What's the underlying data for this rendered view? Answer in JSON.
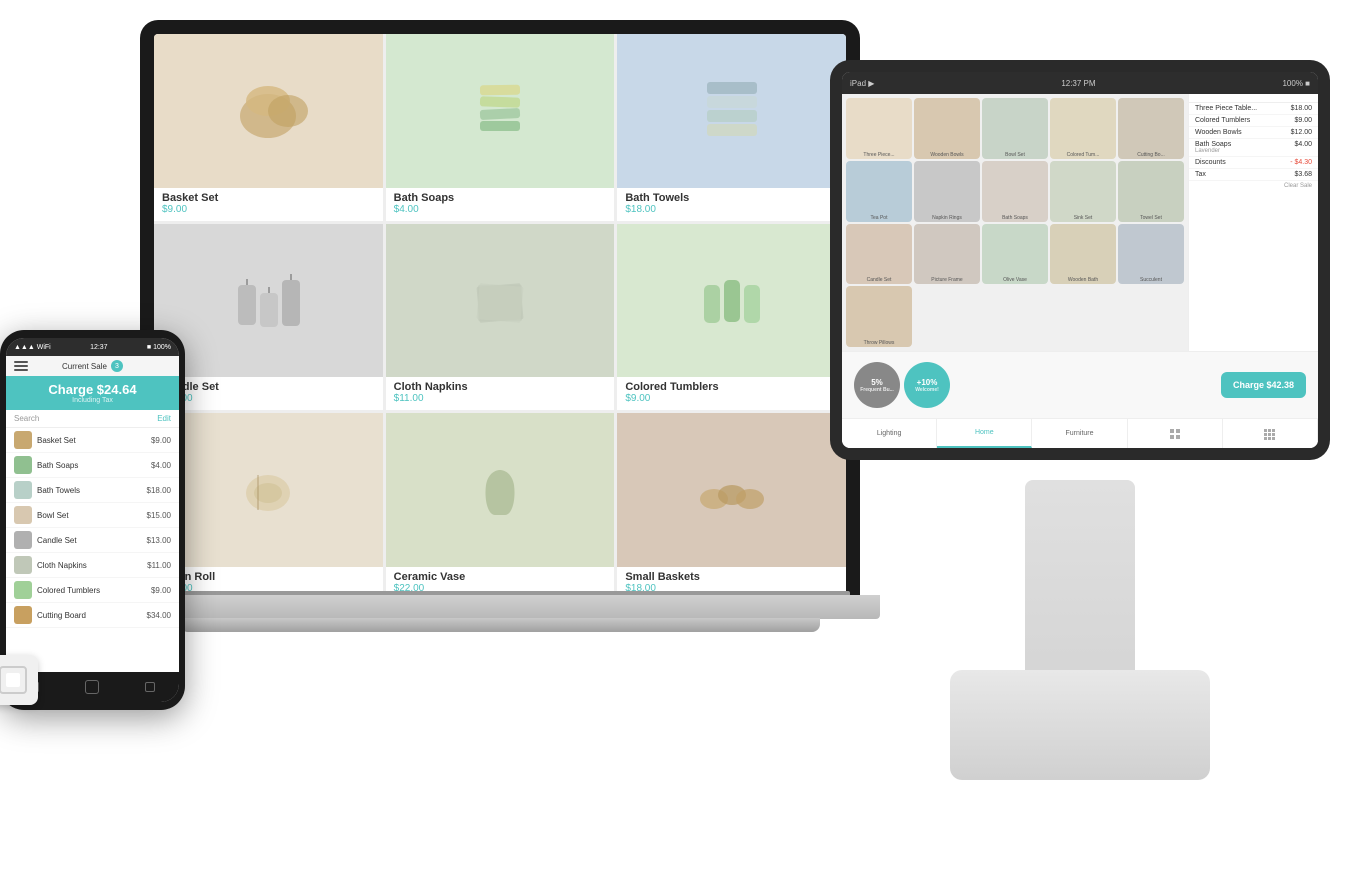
{
  "scene": {
    "bg": "#ffffff"
  },
  "laptop": {
    "products": [
      {
        "name": "Basket Set",
        "price": "$9.00",
        "bg": "#e8dcc8",
        "id": "basket"
      },
      {
        "name": "Bath Soaps",
        "price": "$4.00",
        "bg": "#d4e8d0",
        "id": "soaps"
      },
      {
        "name": "Bath Towels",
        "price": "$18.00",
        "bg": "#c8d8e8",
        "id": "towels"
      },
      {
        "name": "Candle Set",
        "price": "$13.00",
        "bg": "#d8d8d8",
        "id": "candles"
      },
      {
        "name": "Cloth Napkins",
        "price": "$11.00",
        "bg": "#d0d8c8",
        "id": "napkins"
      },
      {
        "name": "Colored Tumblers",
        "price": "$9.00",
        "bg": "#d8e8d0",
        "id": "tumblers"
      },
      {
        "name": "Linen Roll",
        "price": "$14.00",
        "bg": "#e8e0d0",
        "id": "roll"
      },
      {
        "name": "Ceramic Vase",
        "price": "$22.00",
        "bg": "#d8e0c8",
        "id": "vase"
      },
      {
        "name": "Small Baskets",
        "price": "$18.00",
        "bg": "#d8c8b8",
        "id": "baskets2"
      }
    ]
  },
  "pos": {
    "time": "12:37 PM",
    "products": [
      {
        "label": "Three Piece...",
        "bg": "pt1"
      },
      {
        "label": "Wooden Bowls",
        "bg": "pt2"
      },
      {
        "label": "Bowl Set",
        "bg": "pt3"
      },
      {
        "label": "Colored Tum...",
        "bg": "pt4"
      },
      {
        "label": "Cutting Bo...",
        "bg": "pt5"
      },
      {
        "label": "Tea Pot",
        "bg": "pt6"
      },
      {
        "label": "Napkin Rings",
        "bg": "pt7"
      },
      {
        "label": "Bath Soaps",
        "bg": "pt8"
      },
      {
        "label": "Sink Set",
        "bg": "pt9"
      },
      {
        "label": "Towel Set",
        "bg": "pt10"
      },
      {
        "label": "Candle Set",
        "bg": "pt11"
      },
      {
        "label": "Picture Frame",
        "bg": "pt12"
      },
      {
        "label": "Olive Vase",
        "bg": "pt13"
      },
      {
        "label": "Wooden Bath",
        "bg": "pt14"
      },
      {
        "label": "Succulent",
        "bg": "pt15"
      },
      {
        "label": "Throw Pillows",
        "bg": "pt1"
      }
    ],
    "cart_items": [
      {
        "name": "Three Piece Table...",
        "price": "$18.00"
      },
      {
        "name": "Colored Tumblers",
        "price": "$9.00"
      },
      {
        "name": "Wooden Bowls",
        "price": "$12.00"
      },
      {
        "name": "Bath Soaps",
        "price": "$4.00",
        "sub": "Lavender"
      },
      {
        "name": "Discounts",
        "price": "- $4.30",
        "discount": true
      },
      {
        "name": "Tax",
        "price": "$3.68"
      }
    ],
    "clear_sale": "Clear Sale",
    "charge_amount": "Charge $42.38",
    "discount_btn1": "5%",
    "discount_btn2": "+10%",
    "discount_label1": "Frequent Bu...",
    "discount_label2": "Welcome!",
    "nav_tabs": [
      "Lighting",
      "Home",
      "Furniture"
    ]
  },
  "phone": {
    "status_time": "12:37",
    "status_signal": "▲▲▲",
    "header_title": "Current Sale",
    "badge": "3",
    "charge_amount": "Charge $24.64",
    "charge_tax": "Including Tax",
    "search_placeholder": "Search",
    "edit_label": "Edit",
    "cart_items": [
      {
        "name": "Basket Set",
        "price": "$9.00"
      },
      {
        "name": "Bath Soaps",
        "price": "$4.00"
      },
      {
        "name": "Bath Towels",
        "price": "$18.00"
      },
      {
        "name": "Bowl Set",
        "price": "$15.00"
      },
      {
        "name": "Candle Set",
        "price": "$13.00"
      },
      {
        "name": "Cloth Napkins",
        "price": "$11.00"
      },
      {
        "name": "Colored Tumblers",
        "price": "$9.00"
      },
      {
        "name": "Cutting Board",
        "price": "$34.00"
      }
    ]
  }
}
